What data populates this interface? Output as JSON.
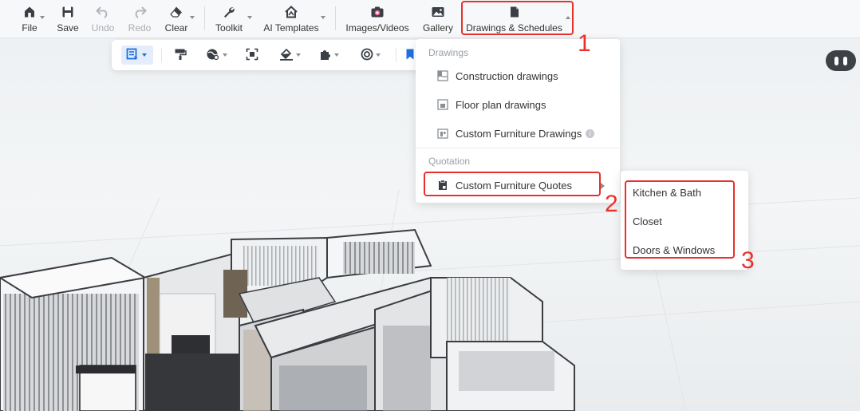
{
  "toolbar": {
    "file": "File",
    "save": "Save",
    "undo": "Undo",
    "redo": "Redo",
    "clear": "Clear",
    "toolkit": "Toolkit",
    "ai_templates": "AI Templates",
    "images_videos": "Images/Videos",
    "gallery": "Gallery",
    "drawings_schedules": "Drawings & Schedules"
  },
  "dropdown": {
    "drawings_header": "Drawings",
    "drawings_items": [
      {
        "label": "Construction drawings",
        "icon": "construction-drawing-icon"
      },
      {
        "label": "Floor plan drawings",
        "icon": "floor-plan-icon"
      },
      {
        "label": "Custom Furniture Drawings",
        "icon": "furniture-drawing-icon"
      }
    ],
    "info_glyph": "i",
    "quotation_header": "Quotation",
    "quotation_items": [
      {
        "label": "Custom Furniture Quotes",
        "icon": "quote-clipboard-icon"
      }
    ]
  },
  "submenu": {
    "items": [
      "Kitchen & Bath",
      "Closet",
      "Doors & Windows"
    ]
  },
  "annotations": {
    "step1": "1",
    "step2": "2",
    "step3": "3",
    "color": "#e8312b"
  },
  "colors": {
    "accent": "#1f6fe0",
    "highlight": "#e8312b",
    "robot": "#3d4045"
  }
}
